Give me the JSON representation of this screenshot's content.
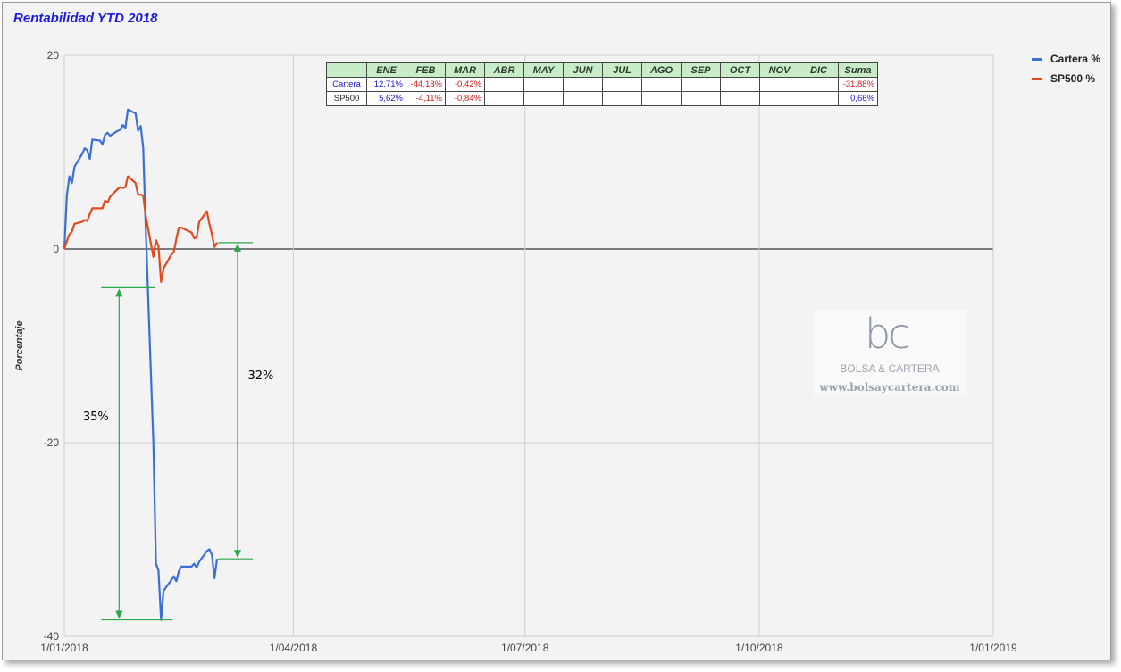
{
  "chart_data": {
    "type": "line",
    "title": "Rentabilidad YTD 2018",
    "ylabel": "Porcentaje",
    "xlabel": "",
    "ylim": [
      -40,
      20
    ],
    "y_ticks": [
      "20",
      "0",
      "-20",
      "-40"
    ],
    "x_ticks": [
      "1/01/2018",
      "1/04/2018",
      "1/07/2018",
      "1/10/2018",
      "1/01/2019"
    ],
    "grid": true,
    "legend_position": "top-right",
    "series": [
      {
        "name": "Cartera %",
        "color": "#3a6fd8",
        "points": [
          [
            "2018-01-01",
            0
          ],
          [
            "2018-01-02",
            5.5
          ],
          [
            "2018-01-03",
            7.5
          ],
          [
            "2018-01-04",
            6.8
          ],
          [
            "2018-01-05",
            8.5
          ],
          [
            "2018-01-08",
            9.8
          ],
          [
            "2018-01-09",
            10.4
          ],
          [
            "2018-01-10",
            10.2
          ],
          [
            "2018-01-11",
            9.3
          ],
          [
            "2018-01-12",
            11.3
          ],
          [
            "2018-01-15",
            11.2
          ],
          [
            "2018-01-16",
            10.8
          ],
          [
            "2018-01-17",
            11.8
          ],
          [
            "2018-01-18",
            12.0
          ],
          [
            "2018-01-19",
            11.7
          ],
          [
            "2018-01-22",
            12.2
          ],
          [
            "2018-01-23",
            12.3
          ],
          [
            "2018-01-24",
            12.8
          ],
          [
            "2018-01-25",
            12.5
          ],
          [
            "2018-01-26",
            14.4
          ],
          [
            "2018-01-29",
            14.0
          ],
          [
            "2018-01-30",
            12.2
          ],
          [
            "2018-01-31",
            12.7
          ],
          [
            "2018-02-01",
            10.5
          ],
          [
            "2018-02-02",
            2.0
          ],
          [
            "2018-02-05",
            -20.0
          ],
          [
            "2018-02-06",
            -32.5
          ],
          [
            "2018-02-07",
            -33.2
          ],
          [
            "2018-02-08",
            -38.3
          ],
          [
            "2018-02-09",
            -35.3
          ],
          [
            "2018-02-12",
            -34.2
          ],
          [
            "2018-02-13",
            -33.8
          ],
          [
            "2018-02-14",
            -34.3
          ],
          [
            "2018-02-15",
            -33.3
          ],
          [
            "2018-02-16",
            -32.8
          ],
          [
            "2018-02-20",
            -32.8
          ],
          [
            "2018-02-21",
            -32.5
          ],
          [
            "2018-02-22",
            -32.9
          ],
          [
            "2018-02-23",
            -32.3
          ],
          [
            "2018-02-26",
            -31.2
          ],
          [
            "2018-02-27",
            -31.0
          ],
          [
            "2018-02-28",
            -31.6
          ],
          [
            "2018-03-01",
            -34.0
          ],
          [
            "2018-03-02",
            -32.0
          ]
        ]
      },
      {
        "name": "SP500 %",
        "color": "#e04a1e",
        "points": [
          [
            "2018-01-01",
            0
          ],
          [
            "2018-01-02",
            0.8
          ],
          [
            "2018-01-03",
            1.5
          ],
          [
            "2018-01-04",
            1.8
          ],
          [
            "2018-01-05",
            2.6
          ],
          [
            "2018-01-08",
            2.8
          ],
          [
            "2018-01-09",
            3.0
          ],
          [
            "2018-01-10",
            2.9
          ],
          [
            "2018-01-11",
            3.6
          ],
          [
            "2018-01-12",
            4.2
          ],
          [
            "2018-01-16",
            4.2
          ],
          [
            "2018-01-17",
            5.0
          ],
          [
            "2018-01-18",
            4.8
          ],
          [
            "2018-01-19",
            5.4
          ],
          [
            "2018-01-22",
            6.2
          ],
          [
            "2018-01-23",
            6.4
          ],
          [
            "2018-01-24",
            6.3
          ],
          [
            "2018-01-25",
            6.4
          ],
          [
            "2018-01-26",
            7.5
          ],
          [
            "2018-01-29",
            6.8
          ],
          [
            "2018-01-30",
            5.6
          ],
          [
            "2018-01-31",
            5.6
          ],
          [
            "2018-02-01",
            5.5
          ],
          [
            "2018-02-02",
            3.4
          ],
          [
            "2018-02-05",
            -0.8
          ],
          [
            "2018-02-06",
            0.9
          ],
          [
            "2018-02-07",
            0.3
          ],
          [
            "2018-02-08",
            -3.4
          ],
          [
            "2018-02-09",
            -2.0
          ],
          [
            "2018-02-12",
            -0.6
          ],
          [
            "2018-02-13",
            -0.3
          ],
          [
            "2018-02-14",
            1.0
          ],
          [
            "2018-02-15",
            2.2
          ],
          [
            "2018-02-16",
            2.2
          ],
          [
            "2018-02-20",
            1.7
          ],
          [
            "2018-02-21",
            1.1
          ],
          [
            "2018-02-22",
            1.2
          ],
          [
            "2018-02-23",
            2.8
          ],
          [
            "2018-02-26",
            3.9
          ],
          [
            "2018-02-27",
            2.6
          ],
          [
            "2018-02-28",
            1.5
          ],
          [
            "2018-03-01",
            0.2
          ],
          [
            "2018-03-02",
            0.66
          ]
        ]
      }
    ],
    "annotations": [
      {
        "label": "35%",
        "from_value": -4.0,
        "to_value": -38.3,
        "date": "2018-02-01",
        "color": "#2aa84a"
      },
      {
        "label": "32%",
        "from_value": 0.66,
        "to_value": -32.0,
        "date": "2018-03-02",
        "color": "#2aa84a"
      }
    ]
  },
  "table": {
    "headers": [
      "ENE",
      "FEB",
      "MAR",
      "ABR",
      "MAY",
      "JUN",
      "JUL",
      "AGO",
      "SEP",
      "OCT",
      "NOV",
      "DIC",
      "Suma"
    ],
    "rows": [
      {
        "label": "Cartera",
        "cells": [
          "12,71%",
          "-44,18%",
          "-0,42%",
          "",
          "",
          "",
          "",
          "",
          "",
          "",
          "",
          "",
          "-31,88%"
        ]
      },
      {
        "label": "SP500",
        "cells": [
          "5,62%",
          "-4,11%",
          "-0,84%",
          "",
          "",
          "",
          "",
          "",
          "",
          "",
          "",
          "",
          "0,66%"
        ]
      }
    ]
  },
  "watermark": {
    "logo": "bc",
    "name": "BOLSA & CARTERA",
    "url": "www.bolsaycartera.com"
  },
  "colors": {
    "positive": "#1a1acc",
    "negative": "#cc1a1a",
    "table_header_bg": "#c8ecc8",
    "title": "#1a1ae8"
  }
}
